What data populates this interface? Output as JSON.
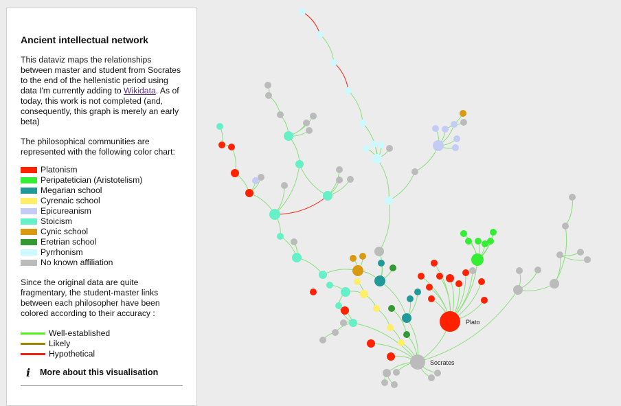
{
  "panel": {
    "title": "Ancient intellectual network",
    "intro_before_link": "This dataviz maps the relationships between master and student from Socrates to the end of the hellenistic period using data I'm currently adding to ",
    "intro_link": "Wikidata",
    "intro_after_link": ". As of today, this work is not completed (and, consequently, this graph is merely an early beta)",
    "communities_intro": "The philosophical communities are represented with the following color chart:",
    "communities": [
      {
        "label": "Platonism",
        "color": "#ff2200"
      },
      {
        "label": "Peripatetician (Aristotelism)",
        "color": "#33ee33"
      },
      {
        "label": "Megarian school",
        "color": "#229999"
      },
      {
        "label": "Cyrenaic school",
        "color": "#ffee66"
      },
      {
        "label": "Epicureanism",
        "color": "#c4ccf6"
      },
      {
        "label": "Stoicism",
        "color": "#66f0c8"
      },
      {
        "label": "Cynic school",
        "color": "#d89a10"
      },
      {
        "label": "Eretrian school",
        "color": "#339933"
      },
      {
        "label": "Pyrrhonism",
        "color": "#ccf8ff"
      },
      {
        "label": "No known affiliation",
        "color": "#bbbbbb"
      }
    ],
    "accuracy_intro": "Since the original data are quite fragmentary, the student-master links between each philosopher have been colored according to their accuracy :",
    "link_types": [
      {
        "label": "Well-established",
        "color": "#55ee22"
      },
      {
        "label": "Likely",
        "color": "#998800"
      },
      {
        "label": "Hypothetical",
        "color": "#ee2211"
      }
    ],
    "more_label": "More about this visualisation"
  },
  "graph": {
    "node_labels": {
      "plato": "Plato",
      "socrates": "Socrates"
    }
  }
}
